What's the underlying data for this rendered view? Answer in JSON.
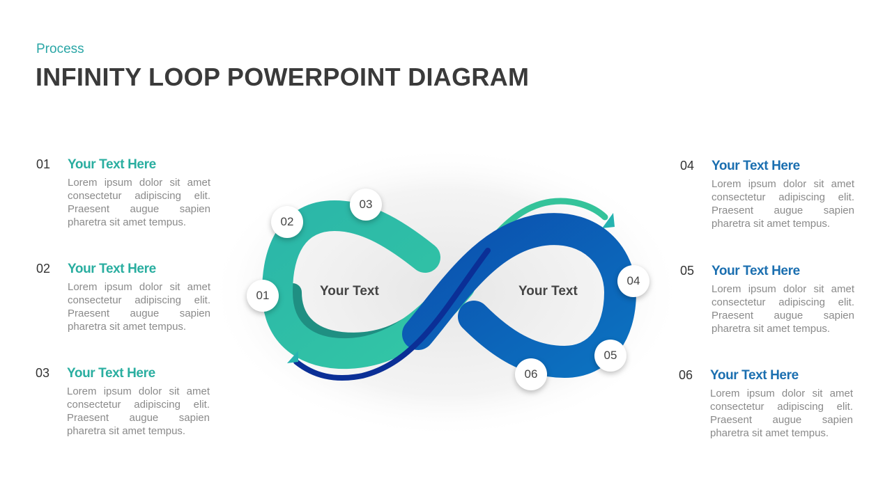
{
  "header": {
    "subtitle": "Process",
    "title": "INFINITY LOOP POWERPOINT DIAGRAM"
  },
  "colors": {
    "accent_teal": "#2aaea0",
    "accent_blue": "#1b6fb0",
    "loop_teal": "#2ec2a6",
    "loop_blue": "#0a63b8",
    "loop_navy": "#0a2f8f"
  },
  "left_items": [
    {
      "number": "01",
      "heading": "Your Text Here",
      "body": "Lorem ipsum dolor sit amet consectetur adipiscing elit. Praesent augue sapien pharetra sit amet tempus."
    },
    {
      "number": "02",
      "heading": "Your Text Here",
      "body": "Lorem ipsum dolor sit amet consectetur adipiscing elit. Praesent augue sapien pharetra sit amet tempus."
    },
    {
      "number": "03",
      "heading": "Your Text Here",
      "body": "Lorem ipsum dolor sit amet consectetur adipiscing elit. Praesent augue sapien pharetra sit amet tempus."
    }
  ],
  "right_items": [
    {
      "number": "04",
      "heading": "Your Text Here",
      "body": "Lorem ipsum dolor sit amet consectetur adipiscing elit. Praesent augue sapien pharetra sit amet tempus."
    },
    {
      "number": "05",
      "heading": "Your Text Here",
      "body": "Lorem ipsum dolor sit amet consectetur adipiscing elit. Praesent augue sapien pharetra sit amet tempus."
    },
    {
      "number": "06",
      "heading": "Your Text Here",
      "body": "Lorem ipsum dolor sit amet consectetur adipiscing elit. Praesent augue sapien pharetra sit amet tempus."
    }
  ],
  "diagram": {
    "left_loop_label": "Your Text",
    "right_loop_label": "Your Text",
    "badges": [
      "01",
      "02",
      "03",
      "04",
      "05",
      "06"
    ]
  }
}
